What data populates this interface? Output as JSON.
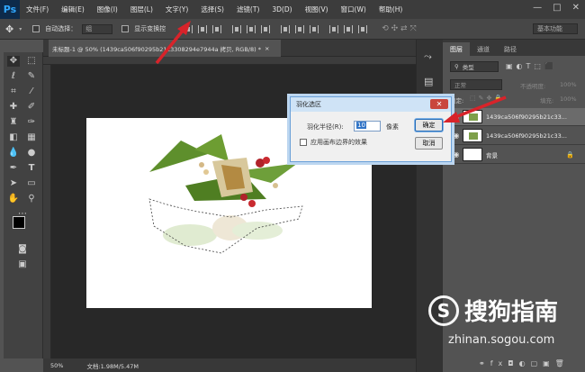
{
  "app": {
    "logo": "Ps"
  },
  "menu": [
    "文件(F)",
    "编辑(E)",
    "图像(I)",
    "图层(L)",
    "文字(Y)",
    "选择(S)",
    "滤镜(T)",
    "3D(D)",
    "视图(V)",
    "窗口(W)",
    "帮助(H)"
  ],
  "window_controls": {
    "minimize": "—",
    "maximize": "□",
    "close": "✕"
  },
  "options_bar": {
    "auto_select_label": "自动选择：",
    "auto_select_value": "组",
    "show_transform_label": "显示变换控",
    "workspace": "基本功能"
  },
  "document_tab": {
    "title": "未标题-1 @ 50% (1439ca506f90295b21c3308294e7944a 拷贝, RGB/8) *",
    "close": "×"
  },
  "status_bar": {
    "zoom": "50%",
    "doc_size": "文档:1.98M/5.47M"
  },
  "layers_panel": {
    "tabs": [
      "图层",
      "通道",
      "路径"
    ],
    "kind_filter": "类型",
    "blend_mode": "正常",
    "opacity_label": "不透明度:",
    "opacity_value": "100%",
    "lock_label": "锁定:",
    "fill_label": "填充:",
    "fill_value": "100%",
    "layers": [
      {
        "name": "1439ca506f90295b21c33..."
      },
      {
        "name": "1439ca506f90295b21c33..."
      },
      {
        "name": "背景"
      }
    ]
  },
  "feather_dialog": {
    "title": "羽化选区",
    "radius_label": "羽化半径(R):",
    "radius_value": "10",
    "unit": "像素",
    "ok": "确定",
    "cancel": "取消",
    "apply_canvas_edge": "应用画布边界的效果"
  },
  "watermark": {
    "logo_letter": "S",
    "brand_cn": "搜狗指南",
    "url": "zhinan.sogou.com"
  },
  "colors": {
    "accent_arrow": "#d8232a",
    "dialog_border": "#6aa0d8",
    "close_button": "#c9463d"
  }
}
